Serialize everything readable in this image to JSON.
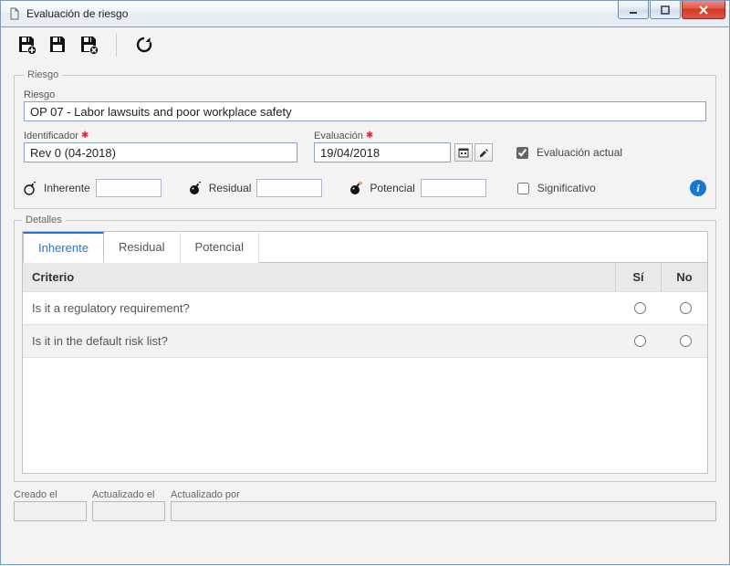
{
  "window": {
    "title": "Evaluación de riesgo"
  },
  "toolbar": {
    "icons": {
      "save_new": "save-plus-icon",
      "save": "save-icon",
      "save_delete": "save-x-icon",
      "refresh": "refresh-icon"
    }
  },
  "riesgo": {
    "legend": "Riesgo",
    "riesgo_label": "Riesgo",
    "riesgo_value": "OP 07 - Labor lawsuits and poor workplace safety",
    "identificador_label": "Identificador",
    "identificador_value": "Rev 0 (04-2018)",
    "evaluacion_label": "Evaluación",
    "evaluacion_value": "19/04/2018",
    "evaluacion_actual_label": "Evaluación actual",
    "evaluacion_actual_checked": true,
    "inherente_label": "Inherente",
    "inherente_value": "",
    "residual_label": "Residual",
    "residual_value": "",
    "potencial_label": "Potencial",
    "potencial_value": "",
    "significativo_label": "Significativo",
    "significativo_checked": false
  },
  "detalles": {
    "legend": "Detalles",
    "tabs": [
      {
        "label": "Inherente",
        "active": true
      },
      {
        "label": "Residual",
        "active": false
      },
      {
        "label": "Potencial",
        "active": false
      }
    ],
    "columns": {
      "criterio": "Criterio",
      "si": "Sí",
      "no": "No"
    },
    "rows": [
      {
        "criterio": "Is it a regulatory requirement?"
      },
      {
        "criterio": "Is it in the default risk list?"
      }
    ]
  },
  "footer": {
    "creado_label": "Creado el",
    "creado_value": "",
    "actualizado_label": "Actualizado el",
    "actualizado_value": "",
    "actualizado_por_label": "Actualizado por",
    "actualizado_por_value": ""
  }
}
